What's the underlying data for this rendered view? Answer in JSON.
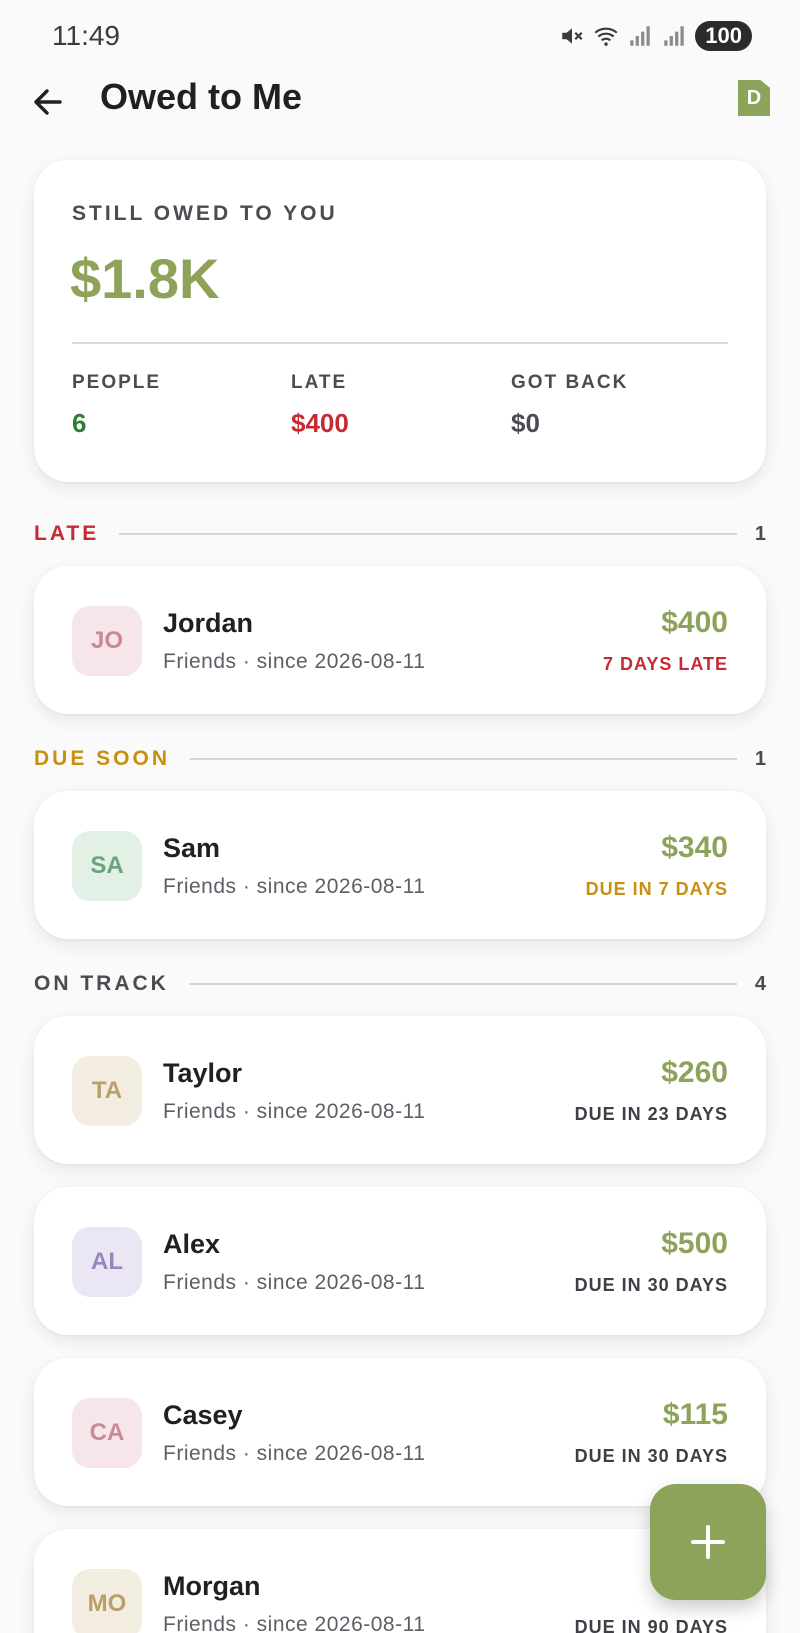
{
  "status_bar": {
    "time": "11:49",
    "battery": "100"
  },
  "header": {
    "title": "Owed to Me",
    "badge": "D"
  },
  "summary": {
    "label": "STILL OWED TO YOU",
    "amount": "$1.8K",
    "stats": [
      {
        "label": "PEOPLE",
        "value": "6"
      },
      {
        "label": "LATE",
        "value": "$400"
      },
      {
        "label": "GOT BACK",
        "value": "$0"
      }
    ]
  },
  "sections": {
    "late": {
      "label": "LATE",
      "count": "1"
    },
    "due_soon": {
      "label": "DUE SOON",
      "count": "1"
    },
    "on_track": {
      "label": "ON TRACK",
      "count": "4"
    }
  },
  "people": [
    {
      "initials": "JO",
      "name": "Jordan",
      "meta": "Friends · since 2026-08-11",
      "amount": "$400",
      "status": "7 DAYS LATE"
    },
    {
      "initials": "SA",
      "name": "Sam",
      "meta": "Friends · since 2026-08-11",
      "amount": "$340",
      "status": "DUE IN 7 DAYS"
    },
    {
      "initials": "TA",
      "name": "Taylor",
      "meta": "Friends · since 2026-08-11",
      "amount": "$260",
      "status": "DUE IN 23 DAYS"
    },
    {
      "initials": "AL",
      "name": "Alex",
      "meta": "Friends · since 2026-08-11",
      "amount": "$500",
      "status": "DUE IN 30 DAYS"
    },
    {
      "initials": "CA",
      "name": "Casey",
      "meta": "Friends · since 2026-08-11",
      "amount": "$115",
      "status": "DUE IN 30 DAYS"
    },
    {
      "initials": "MO",
      "name": "Morgan",
      "meta": "Friends · since 2026-08-11",
      "amount": "$",
      "status": "DUE IN 90 DAYS"
    }
  ],
  "colors": {
    "accent": "#8ea35a",
    "late": "#c62a32",
    "due_soon": "#c8900e",
    "people_green": "#2e7d32"
  },
  "icons": {
    "back": "arrow-left-icon",
    "add": "plus-icon",
    "mute": "mute-icon",
    "wifi": "wifi-icon",
    "signal": "signal-icon"
  }
}
